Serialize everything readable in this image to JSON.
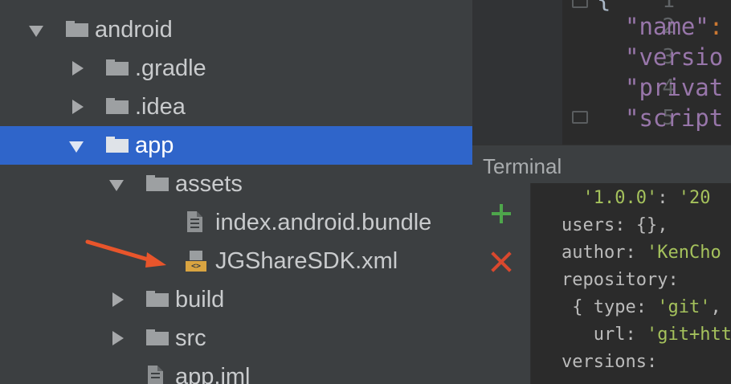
{
  "project_tree": {
    "items": [
      {
        "label": "android",
        "kind": "folder",
        "expanded": true
      },
      {
        "label": ".gradle",
        "kind": "folder",
        "expanded": false
      },
      {
        "label": ".idea",
        "kind": "folder",
        "expanded": false
      },
      {
        "label": "app",
        "kind": "folder",
        "expanded": true,
        "selected": true
      },
      {
        "label": "assets",
        "kind": "folder",
        "expanded": true
      },
      {
        "label": "index.android.bundle",
        "kind": "file"
      },
      {
        "label": "JGShareSDK.xml",
        "kind": "xml-file"
      },
      {
        "label": "build",
        "kind": "folder",
        "expanded": false
      },
      {
        "label": "src",
        "kind": "folder",
        "expanded": false
      },
      {
        "label": "app.iml",
        "kind": "file"
      }
    ],
    "selection_color": "#2f65ca",
    "annotation_arrow_color": "#e8552b"
  },
  "editor": {
    "line_numbers": [
      "1",
      "2",
      "3",
      "4",
      "5"
    ],
    "lines": [
      {
        "text": "\"name\"",
        "punct": ":"
      },
      {
        "text": "\"versio",
        "punct": ""
      },
      {
        "text": "\"privat",
        "punct": ""
      },
      {
        "text": "\"script",
        "punct": ""
      }
    ]
  },
  "terminal": {
    "title": "Terminal",
    "new_session_icon": "plus-icon",
    "close_session_icon": "close-icon",
    "lines": [
      {
        "pre": "  ",
        "str": "'1.0.0'",
        "mid": ": ",
        "str2": "'20"
      },
      {
        "pre": "users: {},",
        "str": "",
        "mid": "",
        "str2": ""
      },
      {
        "pre": "author: ",
        "str": "'KenCho",
        "mid": "",
        "str2": ""
      },
      {
        "pre": "repository:",
        "str": "",
        "mid": "",
        "str2": ""
      },
      {
        "pre": " { type: ",
        "str": "'git'",
        "mid": ",",
        "str2": ""
      },
      {
        "pre": "   url: ",
        "str": "'git+htt",
        "mid": "",
        "str2": ""
      },
      {
        "pre": "versions:",
        "str": "",
        "mid": "",
        "str2": ""
      }
    ]
  }
}
